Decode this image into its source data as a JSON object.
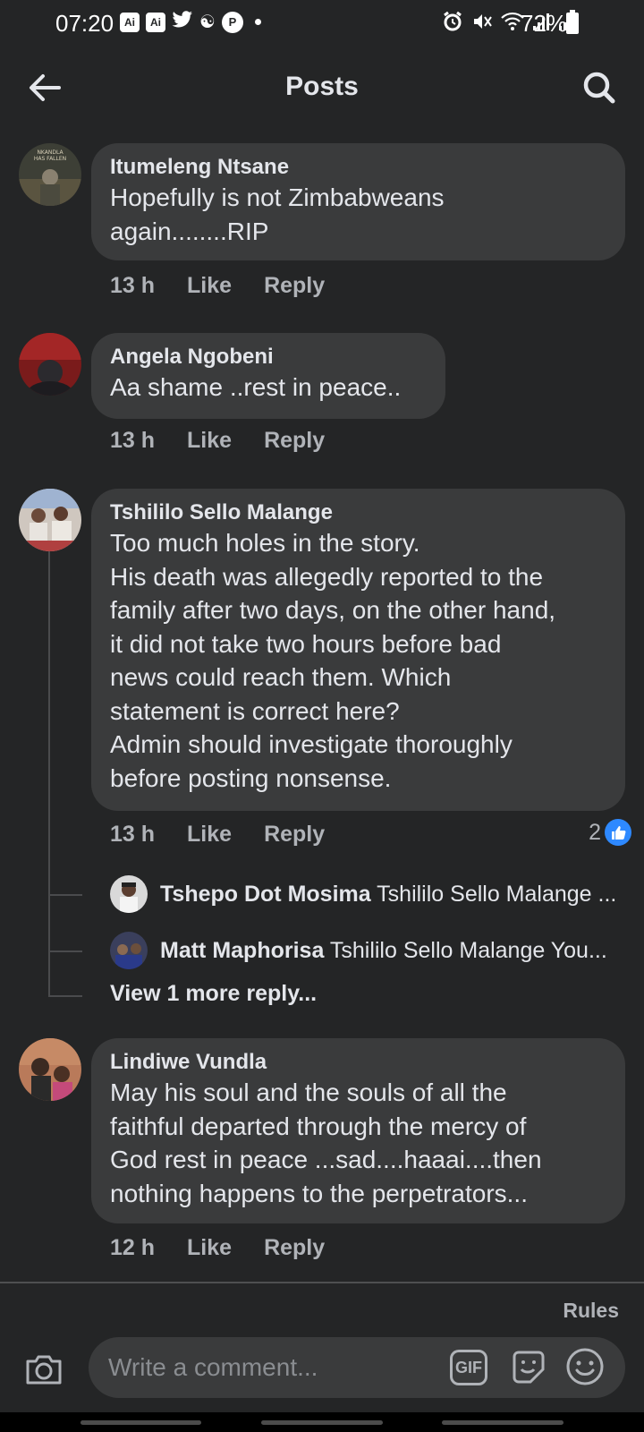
{
  "status_bar": {
    "time": "07:20",
    "battery": "72%",
    "icons": [
      "ai-app-icon",
      "ai-app-icon",
      "twitter-icon",
      "app-icon",
      "app-icon",
      "alarm-icon",
      "mute-icon",
      "wifi-icon",
      "signal-icon",
      "signal-icon",
      "battery-icon"
    ]
  },
  "header": {
    "title": "Posts"
  },
  "comments": [
    {
      "author": "Itumeleng Ntsane",
      "text": "Hopefully is not Zimbabweans\nagain........RIP",
      "time": "13 h",
      "like": "Like",
      "reply": "Reply"
    },
    {
      "author": "Angela Ngobeni",
      "text": "Aa shame ..rest in peace..",
      "time": "13 h",
      "like": "Like",
      "reply": "Reply"
    },
    {
      "author": "Tshililo Sello Malange",
      "text": "Too much holes in the story.\nHis death was allegedly reported to the\nfamily after two days, on the other hand,\nit did not take two hours before bad\nnews could reach them. Which\nstatement is correct here?\nAdmin should investigate thoroughly\nbefore posting nonsense.",
      "time": "13 h",
      "like": "Like",
      "reply": "Reply",
      "reaction_count": "2",
      "replies": [
        {
          "author": "Tshepo Dot Mosima",
          "preview": "Tshililo Sello Malange ..."
        },
        {
          "author": "Matt Maphorisa",
          "preview": "Tshililo Sello Malange You..."
        }
      ],
      "view_more": "View 1 more reply..."
    },
    {
      "author": "Lindiwe Vundla",
      "text": "May his soul and the souls of all the\nfaithful departed through the mercy of\nGod rest in peace ...sad....haaai....then\nnothing happens to the perpetrators...",
      "time": "12 h",
      "like": "Like",
      "reply": "Reply"
    }
  ],
  "footer": {
    "rules": "Rules",
    "comment_placeholder": "Write a comment...",
    "gif_label": "GIF"
  },
  "colors": {
    "background": "#242526",
    "bubble": "#3a3b3c",
    "primary_text": "#e4e6eb",
    "secondary_text": "#b0b3b8",
    "like_blue": "#2e89ff"
  }
}
